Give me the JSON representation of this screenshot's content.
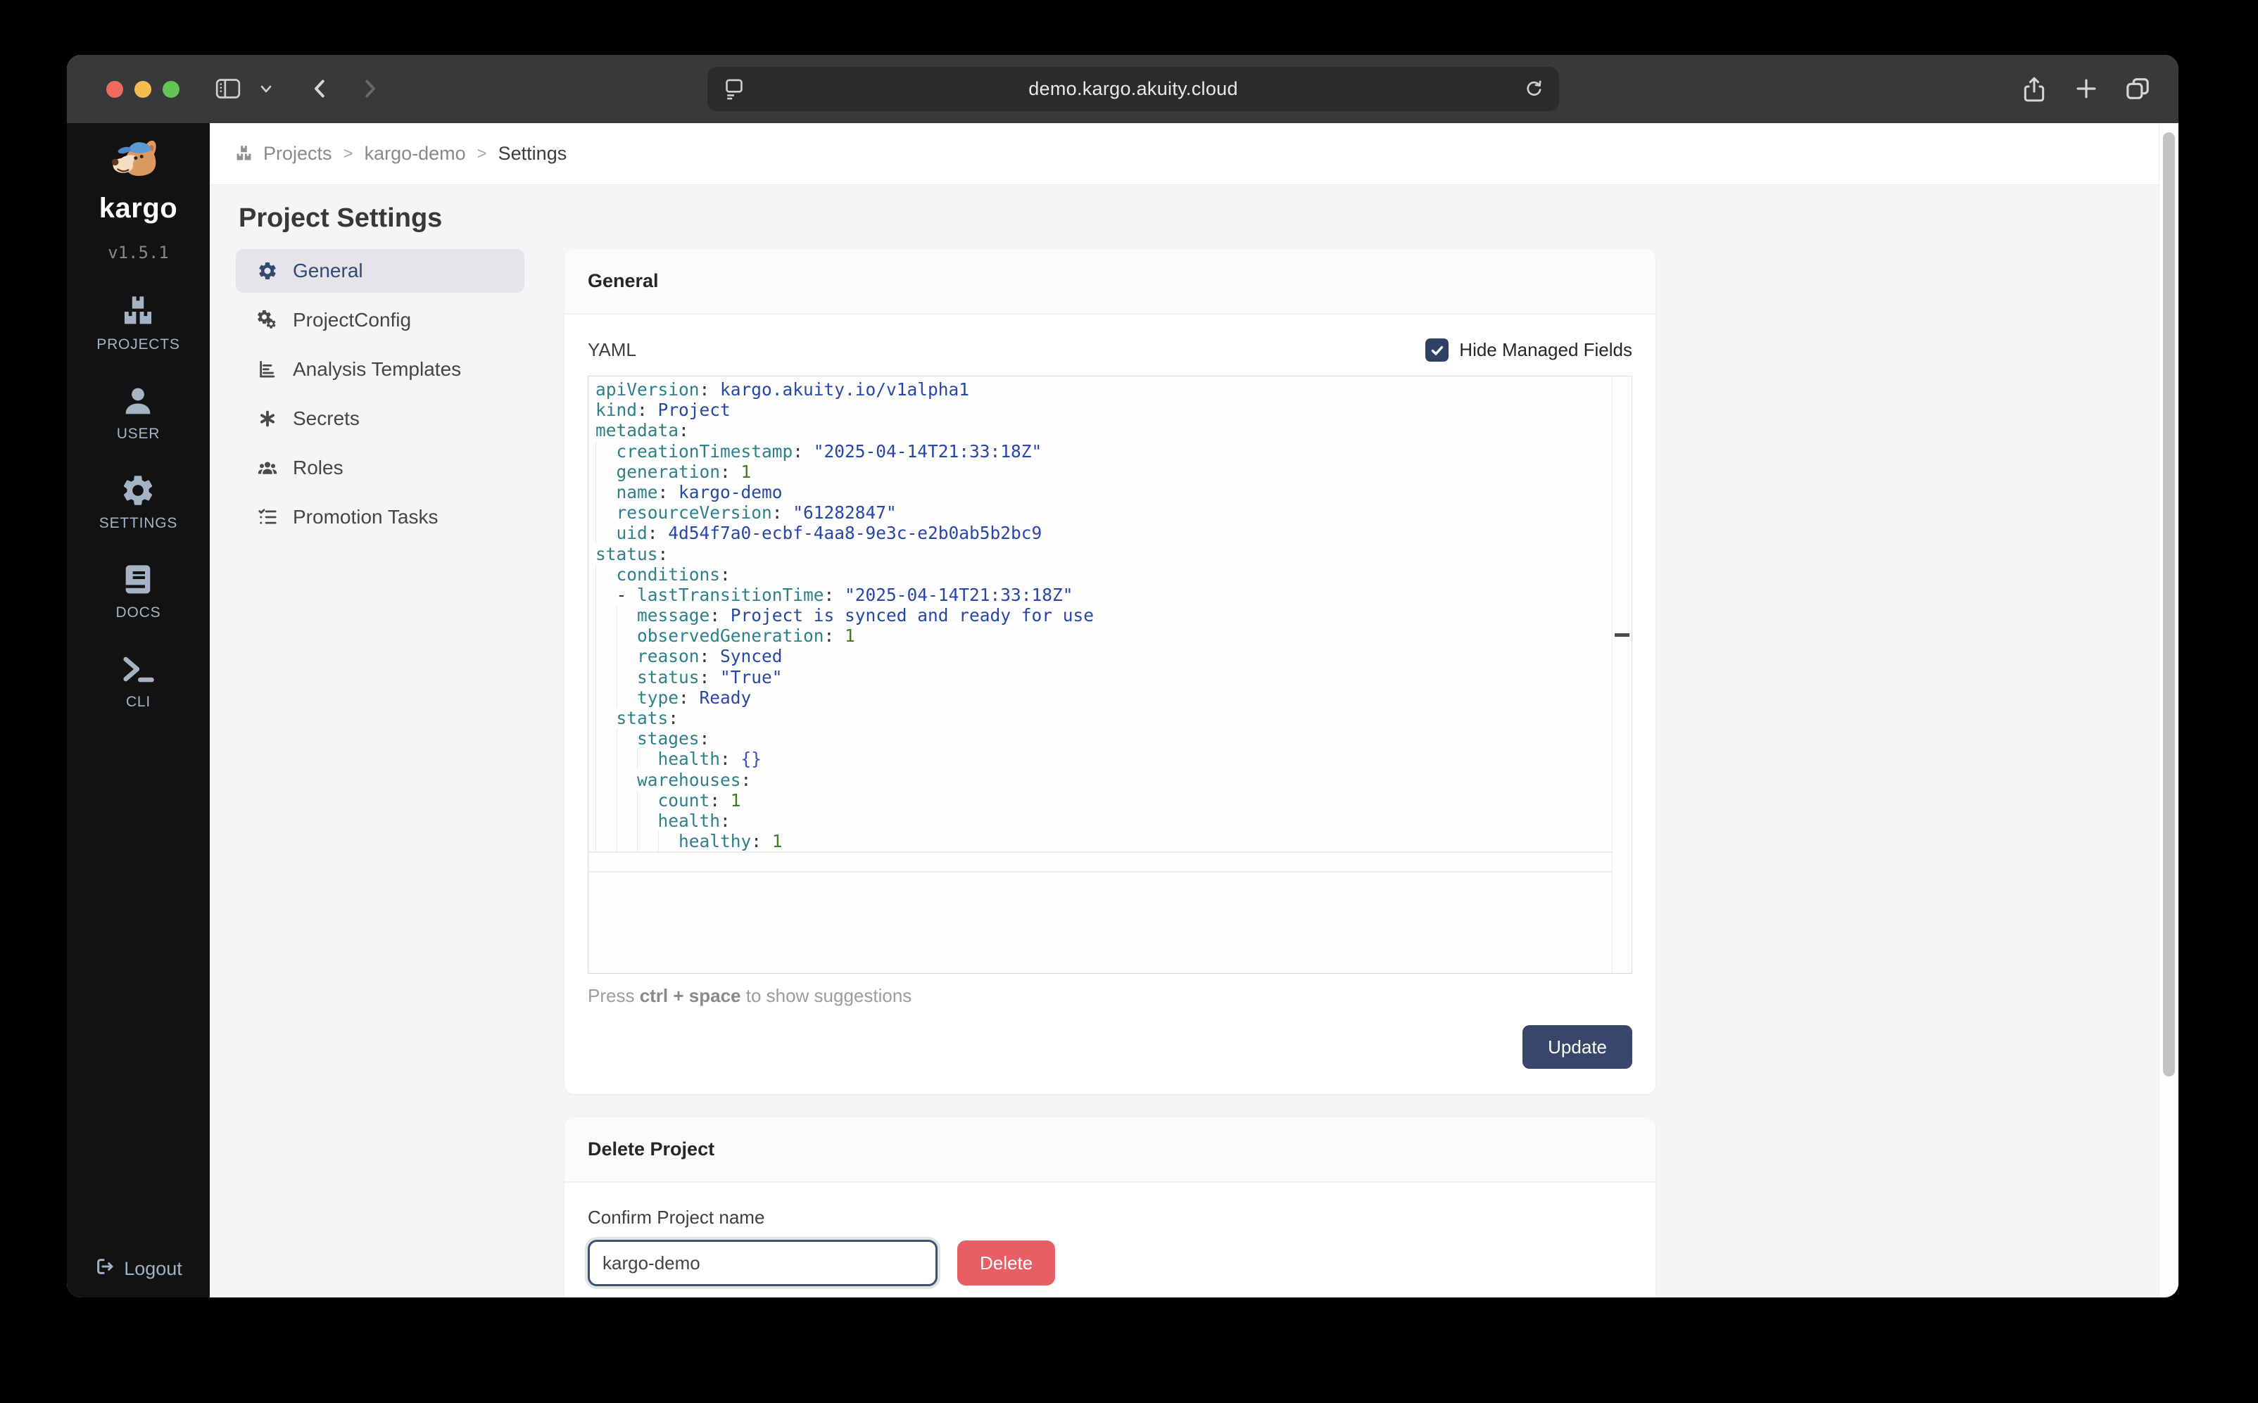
{
  "browser": {
    "url": "demo.kargo.akuity.cloud"
  },
  "sidebar": {
    "logo_text": "kargo",
    "version": "v1.5.1",
    "items": [
      {
        "id": "projects",
        "label": "PROJECTS",
        "icon": "boxes"
      },
      {
        "id": "user",
        "label": "USER",
        "icon": "person"
      },
      {
        "id": "settings",
        "label": "SETTINGS",
        "icon": "gear"
      },
      {
        "id": "docs",
        "label": "DOCS",
        "icon": "book"
      },
      {
        "id": "cli",
        "label": "CLI",
        "icon": "cli"
      }
    ],
    "logout_label": "Logout"
  },
  "breadcrumb": {
    "items": [
      "Projects",
      "kargo-demo",
      "Settings"
    ],
    "separator": ">"
  },
  "page": {
    "title": "Project Settings"
  },
  "settings_nav": [
    {
      "id": "general",
      "label": "General",
      "icon": "gear",
      "selected": true
    },
    {
      "id": "projectconfig",
      "label": "ProjectConfig",
      "icon": "gears",
      "selected": false
    },
    {
      "id": "analysis-templates",
      "label": "Analysis Templates",
      "icon": "chart",
      "selected": false
    },
    {
      "id": "secrets",
      "label": "Secrets",
      "icon": "asterisk",
      "selected": false
    },
    {
      "id": "roles",
      "label": "Roles",
      "icon": "people",
      "selected": false
    },
    {
      "id": "promotion-tasks",
      "label": "Promotion Tasks",
      "icon": "checklist",
      "selected": false
    }
  ],
  "general_card": {
    "title": "General",
    "yaml_label": "YAML",
    "checkbox_label": "Hide Managed Fields",
    "checkbox_checked": true,
    "hint_prefix": "Press ",
    "hint_bold": "ctrl + space",
    "hint_suffix": " to show suggestions",
    "update_label": "Update"
  },
  "yaml_editor": {
    "lines": [
      {
        "indent": 0,
        "tokens": [
          [
            "key",
            "apiVersion"
          ],
          [
            "pun",
            ": "
          ],
          [
            "val",
            "kargo.akuity.io/v1alpha1"
          ]
        ]
      },
      {
        "indent": 0,
        "tokens": [
          [
            "key",
            "kind"
          ],
          [
            "pun",
            ": "
          ],
          [
            "val",
            "Project"
          ]
        ]
      },
      {
        "indent": 0,
        "tokens": [
          [
            "key",
            "metadata"
          ],
          [
            "pun",
            ":"
          ]
        ]
      },
      {
        "indent": 1,
        "tokens": [
          [
            "key",
            "creationTimestamp"
          ],
          [
            "pun",
            ": "
          ],
          [
            "str",
            "\"2025-04-14T21:33:18Z\""
          ]
        ]
      },
      {
        "indent": 1,
        "tokens": [
          [
            "key",
            "generation"
          ],
          [
            "pun",
            ": "
          ],
          [
            "num",
            "1"
          ]
        ]
      },
      {
        "indent": 1,
        "tokens": [
          [
            "key",
            "name"
          ],
          [
            "pun",
            ": "
          ],
          [
            "val",
            "kargo-demo"
          ]
        ]
      },
      {
        "indent": 1,
        "tokens": [
          [
            "key",
            "resourceVersion"
          ],
          [
            "pun",
            ": "
          ],
          [
            "str",
            "\"61282847\""
          ]
        ]
      },
      {
        "indent": 1,
        "tokens": [
          [
            "key",
            "uid"
          ],
          [
            "pun",
            ": "
          ],
          [
            "val",
            "4d54f7a0-ecbf-4aa8-9e3c-e2b0ab5b2bc9"
          ]
        ]
      },
      {
        "indent": 0,
        "tokens": [
          [
            "key",
            "status"
          ],
          [
            "pun",
            ":"
          ]
        ]
      },
      {
        "indent": 1,
        "tokens": [
          [
            "key",
            "conditions"
          ],
          [
            "pun",
            ":"
          ]
        ]
      },
      {
        "indent": 1,
        "tokens": [
          [
            "pun",
            "- "
          ],
          [
            "key",
            "lastTransitionTime"
          ],
          [
            "pun",
            ": "
          ],
          [
            "str",
            "\"2025-04-14T21:33:18Z\""
          ]
        ]
      },
      {
        "indent": 2,
        "tokens": [
          [
            "key",
            "message"
          ],
          [
            "pun",
            ": "
          ],
          [
            "val",
            "Project is synced and ready for use"
          ]
        ]
      },
      {
        "indent": 2,
        "tokens": [
          [
            "key",
            "observedGeneration"
          ],
          [
            "pun",
            ": "
          ],
          [
            "num",
            "1"
          ]
        ]
      },
      {
        "indent": 2,
        "tokens": [
          [
            "key",
            "reason"
          ],
          [
            "pun",
            ": "
          ],
          [
            "val",
            "Synced"
          ]
        ]
      },
      {
        "indent": 2,
        "tokens": [
          [
            "key",
            "status"
          ],
          [
            "pun",
            ": "
          ],
          [
            "str",
            "\"True\""
          ]
        ]
      },
      {
        "indent": 2,
        "tokens": [
          [
            "key",
            "type"
          ],
          [
            "pun",
            ": "
          ],
          [
            "val",
            "Ready"
          ]
        ]
      },
      {
        "indent": 1,
        "tokens": [
          [
            "key",
            "stats"
          ],
          [
            "pun",
            ":"
          ]
        ]
      },
      {
        "indent": 2,
        "tokens": [
          [
            "key",
            "stages"
          ],
          [
            "pun",
            ":"
          ]
        ]
      },
      {
        "indent": 3,
        "tokens": [
          [
            "key",
            "health"
          ],
          [
            "pun",
            ": "
          ],
          [
            "obj",
            "{}"
          ]
        ]
      },
      {
        "indent": 2,
        "tokens": [
          [
            "key",
            "warehouses"
          ],
          [
            "pun",
            ":"
          ]
        ]
      },
      {
        "indent": 3,
        "tokens": [
          [
            "key",
            "count"
          ],
          [
            "pun",
            ": "
          ],
          [
            "num",
            "1"
          ]
        ]
      },
      {
        "indent": 3,
        "tokens": [
          [
            "key",
            "health"
          ],
          [
            "pun",
            ":"
          ]
        ]
      },
      {
        "indent": 4,
        "tokens": [
          [
            "key",
            "healthy"
          ],
          [
            "pun",
            ": "
          ],
          [
            "num",
            "1"
          ]
        ]
      }
    ]
  },
  "delete_card": {
    "title": "Delete Project",
    "confirm_label": "Confirm Project name",
    "input_value": "kargo-demo",
    "delete_label": "Delete"
  },
  "colors": {
    "accent_navy": "#36476b",
    "selected_nav_bg": "#e4e4e9",
    "delete_red": "#e75f64",
    "checkbox_navy": "#2e4063",
    "traffic_red": "#ee6a5f",
    "traffic_yellow": "#f5bd4f",
    "traffic_green": "#62c554",
    "yaml_key": "#2e7f8a",
    "yaml_value": "#2846a8",
    "yaml_number": "#3f7d20"
  }
}
